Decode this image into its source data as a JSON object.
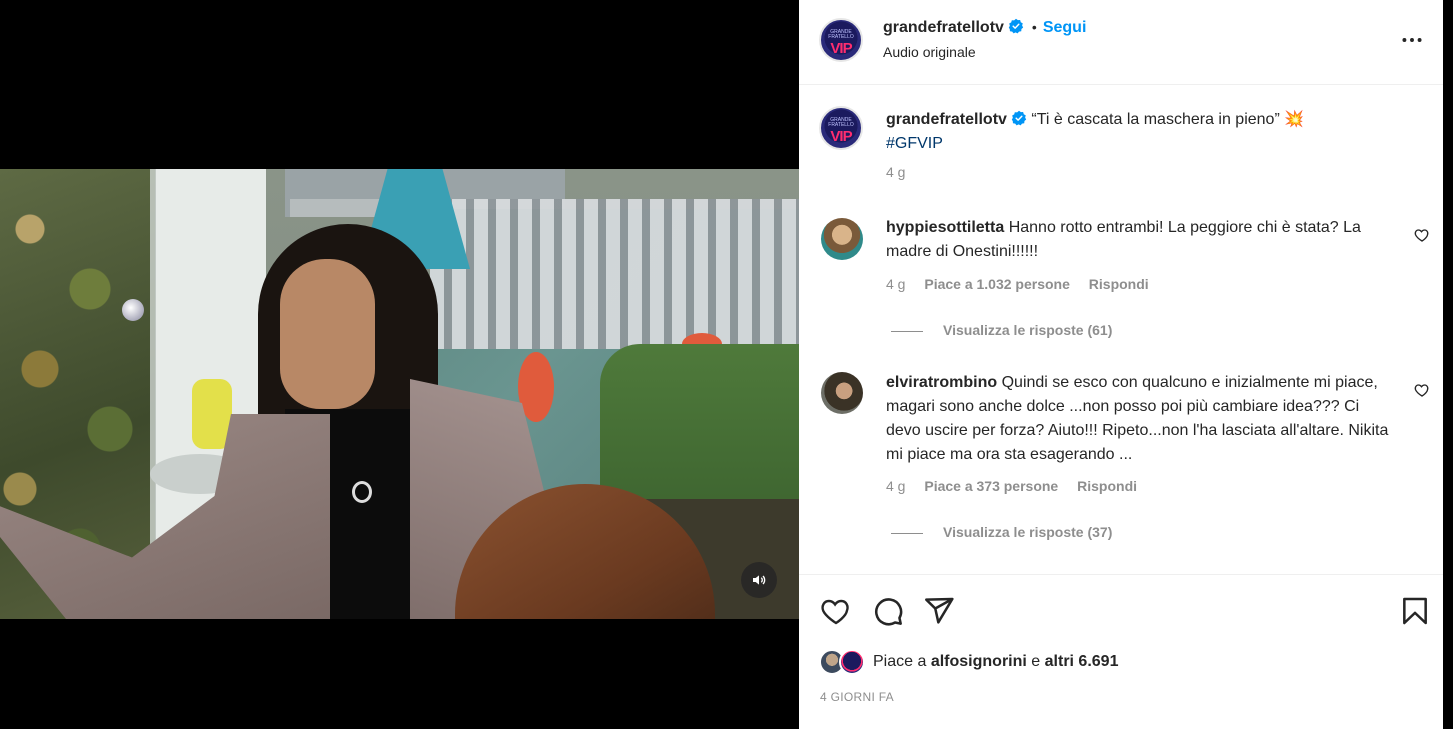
{
  "post": {
    "username": "grandefratellotv",
    "follow_label": "Segui",
    "separator": "•",
    "audio": "Audio originale",
    "more_label": "•••",
    "avatar_logo_text": "GRANDE FRATELLO",
    "avatar_logo_vip": "VIP"
  },
  "caption": {
    "username": "grandefratellotv",
    "text": "“Ti è cascata la maschera in pieno”",
    "emoji": "💥",
    "hashtag": "#GFVIP",
    "time": "4 g"
  },
  "comments": [
    {
      "username": "hyppiesottiletta",
      "text": "Hanno rotto entrambi! La peggiore chi è stata? La madre di Onestini!!!!!!",
      "time": "4 g",
      "likes": "Piace a 1.032 persone",
      "reply": "Rispondi",
      "view_replies": "Visualizza le risposte (61)"
    },
    {
      "username": "elviratrombino",
      "text": "Quindi se esco con qualcuno e inizialmente mi piace, magari sono anche dolce ...non posso poi più cambiare idea??? Ci devo uscire per forza? Aiuto!!! Ripeto...non l'ha lasciata all'altare. Nikita mi piace ma ora sta esagerando ...",
      "time": "4 g",
      "likes": "Piace a 373 persone",
      "reply": "Rispondi",
      "view_replies": "Visualizza le risposte (37)"
    }
  ],
  "actions": {
    "likes_prefix": "Piace a",
    "likes_user": "alfosignorini",
    "likes_middle": "e",
    "likes_rest": "altri 6.691",
    "date": "4 GIORNI FA"
  },
  "colors": {
    "accent": "#0095f6",
    "verified": "#0095f6",
    "secondary_text": "#8e8e8e",
    "hashtag": "#00376b"
  },
  "icons": [
    "verified-badge-icon",
    "more-options-icon",
    "heart-icon",
    "comment-icon",
    "share-icon",
    "bookmark-icon",
    "volume-icon"
  ]
}
